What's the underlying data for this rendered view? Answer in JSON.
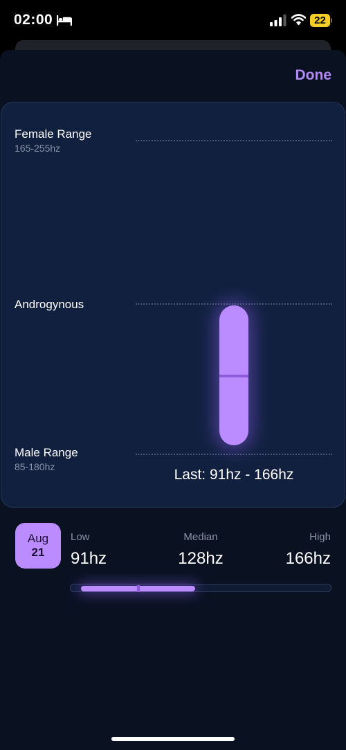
{
  "status_bar": {
    "time": "02:00",
    "battery": "22",
    "icons": [
      "bed-icon",
      "signal-icon",
      "wifi-icon",
      "battery-icon"
    ]
  },
  "header": {
    "done_label": "Done"
  },
  "chart": {
    "ranges": {
      "female": {
        "label": "Female Range",
        "sub": "165-255hz"
      },
      "androgynous": {
        "label": "Androgynous"
      },
      "male": {
        "label": "Male Range",
        "sub": "85-180hz"
      }
    },
    "last_label": "Last: 91hz - 166hz"
  },
  "chart_data": {
    "type": "bar",
    "categories": [
      "Last"
    ],
    "series": [
      {
        "low_hz": 91,
        "median_hz": 128,
        "high_hz": 166
      }
    ],
    "reference_lines": [
      {
        "label": "Female Range"
      },
      {
        "label": "Androgynous"
      },
      {
        "label": "Male Range"
      }
    ]
  },
  "session": {
    "month": "Aug",
    "day": "21",
    "low_label": "Low",
    "low_value": "91hz",
    "median_label": "Median",
    "median_value": "128hz",
    "high_label": "High",
    "high_value": "166hz",
    "track": {
      "low_fraction": 0.04,
      "median_fraction": 0.26,
      "high_fraction": 0.48
    }
  },
  "colors": {
    "accent": "#bb8cff",
    "accent_dark": "#8d5bdc",
    "done": "#b48cf7",
    "card": "#122040",
    "sheet": "#0a1222",
    "battery": "#f5cf28"
  }
}
